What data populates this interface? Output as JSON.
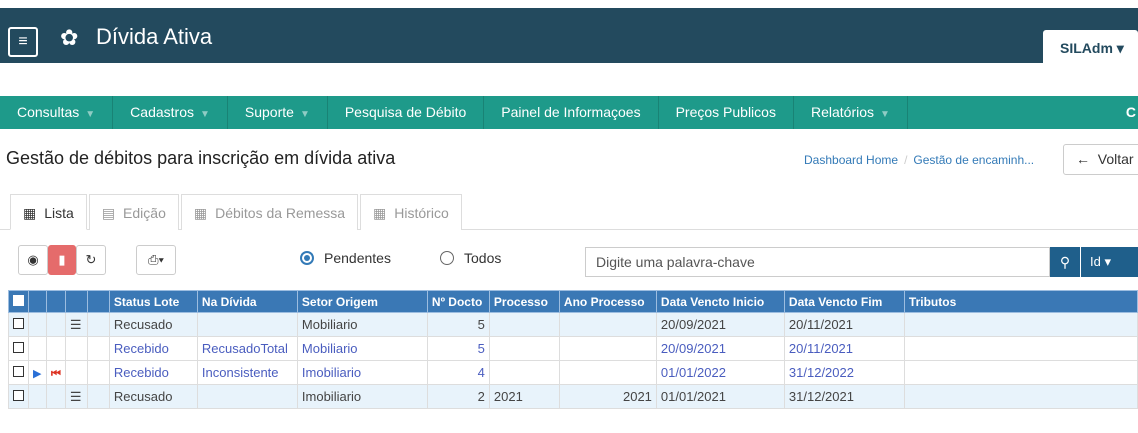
{
  "header": {
    "menu_icon": "menu-icon",
    "gear_icon": "gear-icon",
    "title": "Dívida Ativa",
    "user": "SILAdm"
  },
  "nav": {
    "items": [
      "Consultas",
      "Cadastros",
      "Suporte",
      "Pesquisa de Débito",
      "Painel de Informaçoes",
      "Preços Publicos",
      "Relatórios"
    ],
    "end": "C"
  },
  "page": {
    "title": "Gestão de débitos para inscrição em dívida ativa"
  },
  "breadcrumb": {
    "home": "Dashboard Home",
    "current": "Gestão de encaminh..."
  },
  "back_button": "Voltar",
  "tabs": [
    "Lista",
    "Edição",
    "Débitos da Remessa",
    "Histórico"
  ],
  "toolbar": {
    "radio_pendentes": "Pendentes",
    "radio_todos": "Todos",
    "search_placeholder": "Digite uma palavra-chave",
    "id_label": "Id"
  },
  "table": {
    "headers": [
      "Status Lote",
      "Na Dívida",
      "Setor Origem",
      "Nº Docto",
      "Processo",
      "Ano Processo",
      "Data Vencto Inicio",
      "Data Vencto Fim",
      "Tributos"
    ],
    "rows": [
      {
        "status": "Recusado",
        "divida": "",
        "setor": "Mobiliario",
        "docto": "5",
        "processo": "",
        "ano": "",
        "inicio": "20/09/2021",
        "fim": "20/11/2021",
        "tributos": ""
      },
      {
        "status": "Recebido",
        "divida": "RecusadoTotal",
        "setor": "Mobiliario",
        "docto": "5",
        "processo": "",
        "ano": "",
        "inicio": "20/09/2021",
        "fim": "20/11/2021",
        "tributos": ""
      },
      {
        "status": "Recebido",
        "divida": "Inconsistente",
        "setor": "Imobiliario",
        "docto": "4",
        "processo": "",
        "ano": "",
        "inicio": "01/01/2022",
        "fim": "31/12/2022",
        "tributos": ""
      },
      {
        "status": "Recusado",
        "divida": "",
        "setor": "Imobiliario",
        "docto": "2",
        "processo": "2021",
        "ano": "2021",
        "inicio": "01/01/2021",
        "fim": "31/12/2021",
        "tributos": ""
      }
    ]
  },
  "colors": {
    "header_bg": "#234a5e",
    "nav_bg": "#1e9a8a",
    "table_header": "#3a78b5"
  }
}
